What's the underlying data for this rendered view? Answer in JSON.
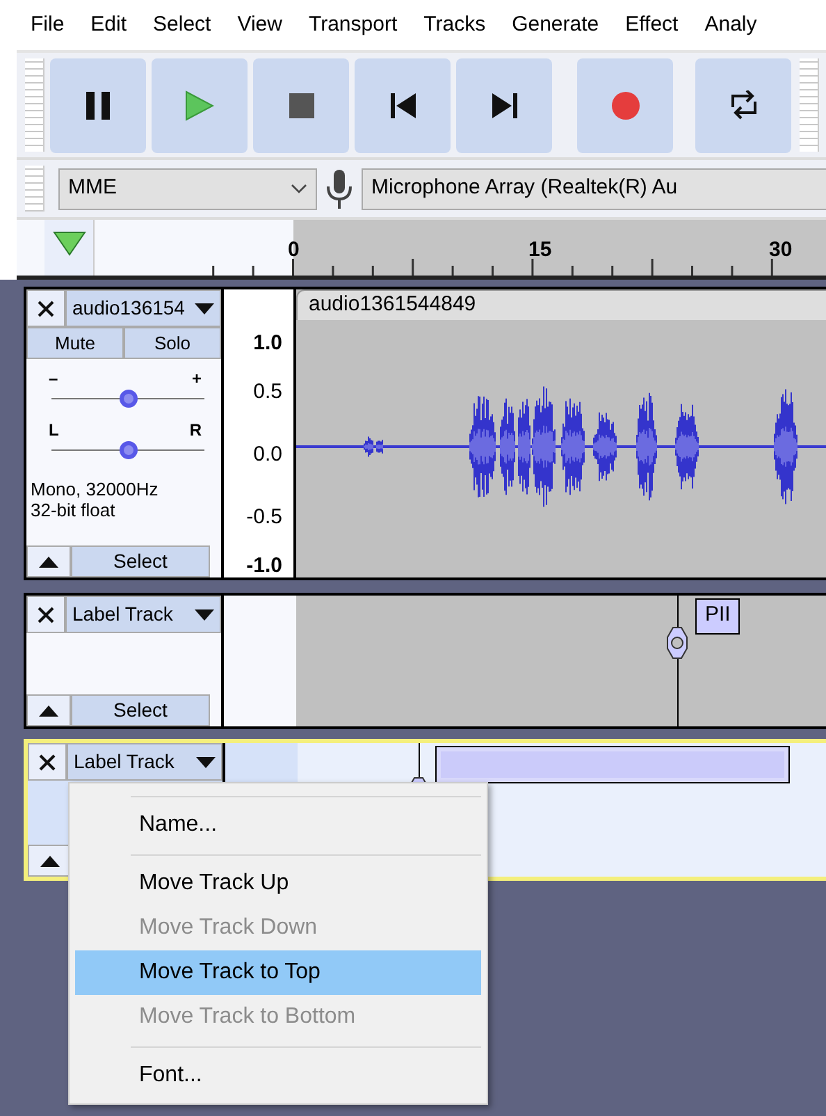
{
  "menu_bar": [
    "File",
    "Edit",
    "Select",
    "View",
    "Transport",
    "Tracks",
    "Generate",
    "Effect",
    "Analy"
  ],
  "transport_buttons": [
    {
      "kind": "pause"
    },
    {
      "kind": "play"
    },
    {
      "kind": "stop"
    },
    {
      "kind": "skip_start"
    },
    {
      "kind": "skip_end"
    },
    {
      "kind": "record"
    },
    {
      "kind": "loop"
    }
  ],
  "device_toolbar": {
    "host": "MME",
    "recording_device": "Microphone Array (Realtek(R) Au"
  },
  "timeline": {
    "ticks": [
      "0",
      "15",
      "30"
    ]
  },
  "tracks": [
    {
      "kind": "audio",
      "selected": false,
      "name": "audio136154",
      "clip_name": "audio1361544849",
      "mute": "Mute",
      "solo": "Solo",
      "gain_slider": {
        "min_label": "–",
        "max_label": "+",
        "level": 0.5
      },
      "pan_slider": {
        "min_label": "L",
        "max_label": "R",
        "level": 0.5
      },
      "info": [
        "Mono, 32000Hz",
        "32-bit float"
      ],
      "select": "Select",
      "scale": [
        "1.0",
        "0.5",
        "0.0",
        "-0.5",
        "-1.0"
      ]
    },
    {
      "kind": "label",
      "selected": false,
      "name": "Label Track",
      "select": "Select",
      "labels": [
        {
          "text": "PII",
          "editing": false
        }
      ]
    },
    {
      "kind": "label",
      "selected": true,
      "name": "Label Track",
      "labels": [
        {
          "editing": true
        }
      ]
    }
  ],
  "context_menu": {
    "items": [
      {
        "kind": "separator"
      },
      {
        "kind": "item",
        "label": "Name...",
        "disabled": false,
        "selected": false
      },
      {
        "kind": "separator"
      },
      {
        "kind": "item",
        "label": "Move Track Up",
        "disabled": false,
        "selected": false
      },
      {
        "kind": "item",
        "label": "Move Track Down",
        "disabled": true,
        "selected": false
      },
      {
        "kind": "item",
        "label": "Move Track to Top",
        "disabled": false,
        "selected": true
      },
      {
        "kind": "item",
        "label": "Move Track to Bottom",
        "disabled": true,
        "selected": false
      },
      {
        "kind": "separator"
      },
      {
        "kind": "item",
        "label": "Font...",
        "disabled": false,
        "selected": false
      }
    ]
  }
}
